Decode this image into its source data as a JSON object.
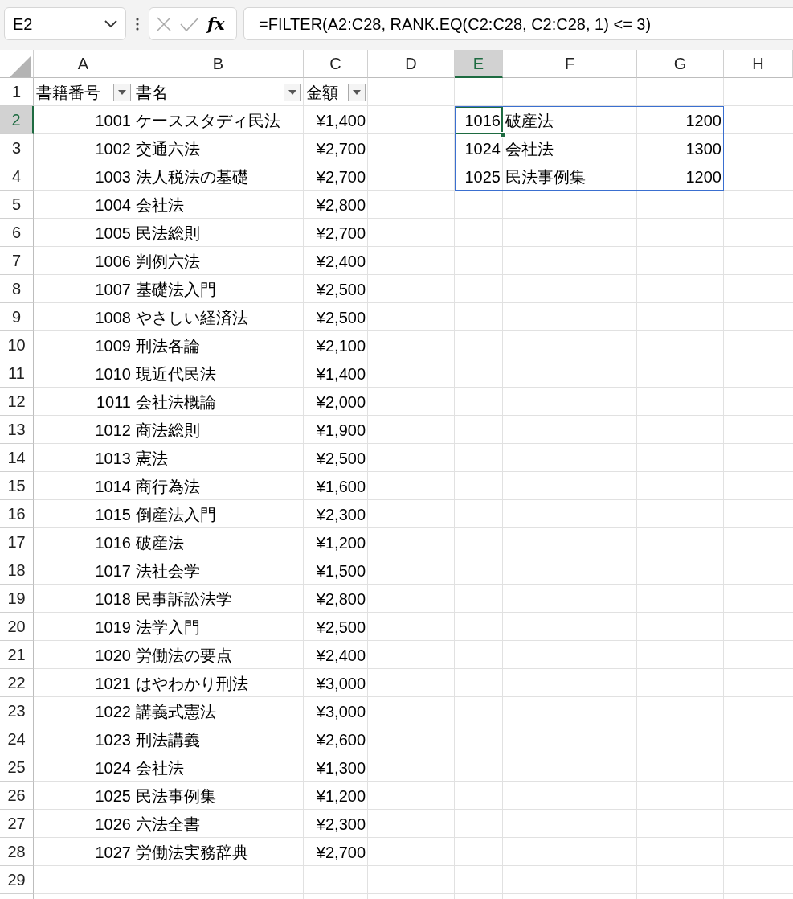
{
  "formula_bar": {
    "name_box": "E2",
    "function_label": "fx",
    "formula": "=FILTER(A2:C28, RANK.EQ(C2:C28, C2:C28, 1) <= 3)"
  },
  "columns": [
    {
      "label": "A",
      "selected": false
    },
    {
      "label": "B",
      "selected": false
    },
    {
      "label": "C",
      "selected": false
    },
    {
      "label": "D",
      "selected": false
    },
    {
      "label": "E",
      "selected": true
    },
    {
      "label": "F",
      "selected": false
    },
    {
      "label": "G",
      "selected": false
    },
    {
      "label": "H",
      "selected": false
    }
  ],
  "header_row": {
    "number": "1",
    "selected": false,
    "cells": [
      {
        "text": "書籍番号",
        "filter": true
      },
      {
        "text": "書名",
        "filter": true
      },
      {
        "text": "金額",
        "filter": true
      }
    ]
  },
  "rows": [
    {
      "number": "2",
      "selected": true,
      "id": "1001",
      "title": "ケーススタディ民法",
      "price": "¥1,400"
    },
    {
      "number": "3",
      "selected": false,
      "id": "1002",
      "title": "交通六法",
      "price": "¥2,700"
    },
    {
      "number": "4",
      "selected": false,
      "id": "1003",
      "title": "法人税法の基礎",
      "price": "¥2,700"
    },
    {
      "number": "5",
      "selected": false,
      "id": "1004",
      "title": "会社法",
      "price": "¥2,800"
    },
    {
      "number": "6",
      "selected": false,
      "id": "1005",
      "title": "民法総則",
      "price": "¥2,700"
    },
    {
      "number": "7",
      "selected": false,
      "id": "1006",
      "title": "判例六法",
      "price": "¥2,400"
    },
    {
      "number": "8",
      "selected": false,
      "id": "1007",
      "title": "基礎法入門",
      "price": "¥2,500"
    },
    {
      "number": "9",
      "selected": false,
      "id": "1008",
      "title": "やさしい経済法",
      "price": "¥2,500"
    },
    {
      "number": "10",
      "selected": false,
      "id": "1009",
      "title": "刑法各論",
      "price": "¥2,100"
    },
    {
      "number": "11",
      "selected": false,
      "id": "1010",
      "title": "現近代民法",
      "price": "¥1,400"
    },
    {
      "number": "12",
      "selected": false,
      "id": "1011",
      "title": "会社法概論",
      "price": "¥2,000"
    },
    {
      "number": "13",
      "selected": false,
      "id": "1012",
      "title": "商法総則",
      "price": "¥1,900"
    },
    {
      "number": "14",
      "selected": false,
      "id": "1013",
      "title": "憲法",
      "price": "¥2,500"
    },
    {
      "number": "15",
      "selected": false,
      "id": "1014",
      "title": "商行為法",
      "price": "¥1,600"
    },
    {
      "number": "16",
      "selected": false,
      "id": "1015",
      "title": "倒産法入門",
      "price": "¥2,300"
    },
    {
      "number": "17",
      "selected": false,
      "id": "1016",
      "title": "破産法",
      "price": "¥1,200"
    },
    {
      "number": "18",
      "selected": false,
      "id": "1017",
      "title": "法社会学",
      "price": "¥1,500"
    },
    {
      "number": "19",
      "selected": false,
      "id": "1018",
      "title": "民事訴訟法学",
      "price": "¥2,800"
    },
    {
      "number": "20",
      "selected": false,
      "id": "1019",
      "title": "法学入門",
      "price": "¥2,500"
    },
    {
      "number": "21",
      "selected": false,
      "id": "1020",
      "title": "労働法の要点",
      "price": "¥2,400"
    },
    {
      "number": "22",
      "selected": false,
      "id": "1021",
      "title": "はやわかり刑法",
      "price": "¥3,000"
    },
    {
      "number": "23",
      "selected": false,
      "id": "1022",
      "title": "講義式憲法",
      "price": "¥3,000"
    },
    {
      "number": "24",
      "selected": false,
      "id": "1023",
      "title": "刑法講義",
      "price": "¥2,600"
    },
    {
      "number": "25",
      "selected": false,
      "id": "1024",
      "title": "会社法",
      "price": "¥1,300"
    },
    {
      "number": "26",
      "selected": false,
      "id": "1025",
      "title": "民法事例集",
      "price": "¥1,200"
    },
    {
      "number": "27",
      "selected": false,
      "id": "1026",
      "title": "六法全書",
      "price": "¥2,300"
    },
    {
      "number": "28",
      "selected": false,
      "id": "1027",
      "title": "労働法実務辞典",
      "price": "¥2,700"
    },
    {
      "number": "29",
      "selected": false
    }
  ],
  "spill_result": {
    "rows": [
      {
        "id": "1016",
        "title": "破産法",
        "price": "1200",
        "active": true
      },
      {
        "id": "1024",
        "title": "会社法",
        "price": "1300",
        "active": false
      },
      {
        "id": "1025",
        "title": "民法事例集",
        "price": "1200",
        "active": false
      }
    ]
  }
}
